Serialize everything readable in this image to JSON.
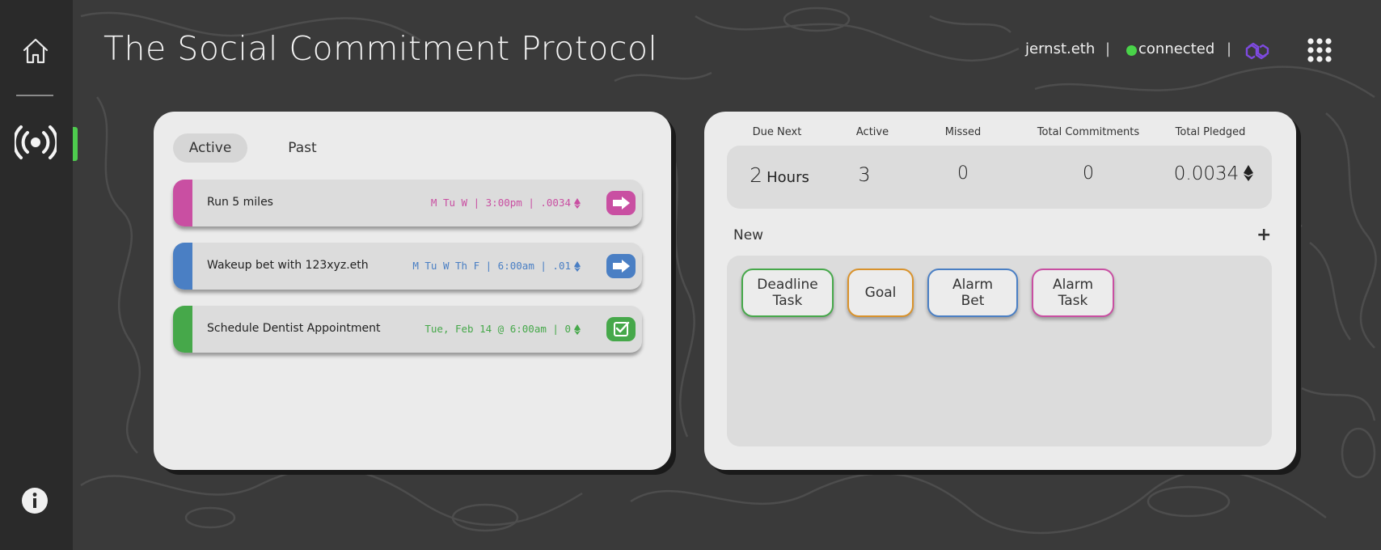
{
  "header": {
    "title": "The Social Commitment Protocol",
    "wallet": "jernst.eth",
    "separator": "|",
    "status": "connected",
    "status_color": "#49d349",
    "network_icon": "polygon-icon",
    "menu_icon": "grid-menu-icon"
  },
  "sidebar": {
    "items": [
      {
        "icon": "home-icon"
      },
      {
        "icon": "broadcast-icon",
        "active": true
      },
      {
        "icon": "info-icon"
      }
    ],
    "active_color": "#4ecb4e"
  },
  "commitments": {
    "tabs": [
      {
        "label": "Active",
        "selected": true
      },
      {
        "label": "Past",
        "selected": false
      }
    ],
    "items": [
      {
        "title": "Run 5 miles",
        "meta": "M  Tu  W  |  3:00pm  |  .0034",
        "color": "#c94fa2",
        "action_icon": "arrow-right-icon"
      },
      {
        "title": "Wakeup bet with 123xyz.eth",
        "meta": "M  Tu  W  Th  F  | 6:00am  |  .01",
        "color": "#4a7fc4",
        "action_icon": "arrow-right-icon"
      },
      {
        "title": "Schedule Dentist Appointment",
        "meta": "Tue, Feb 14 @ 6:00am  |  0",
        "color": "#46a84a",
        "action_icon": "checkbox-icon"
      }
    ]
  },
  "stats": {
    "headers": [
      "Due Next",
      "Active",
      "Missed",
      "Total Commitments",
      "Total Pledged"
    ],
    "due_next_value": "2",
    "due_next_unit": "Hours",
    "active": "3",
    "missed": "0",
    "total_commitments": "0",
    "total_pledged": "0.0034"
  },
  "new_section": {
    "label": "New",
    "add_label": "+",
    "types": [
      {
        "line1": "Deadline",
        "line2": "Task",
        "color": "#46a84a"
      },
      {
        "line1": "Goal",
        "line2": "",
        "color": "#d9922b"
      },
      {
        "line1": "Alarm",
        "line2": "Bet",
        "color": "#4a7fc4"
      },
      {
        "line1": "Alarm",
        "line2": "Task",
        "color": "#c94fa2"
      }
    ]
  }
}
